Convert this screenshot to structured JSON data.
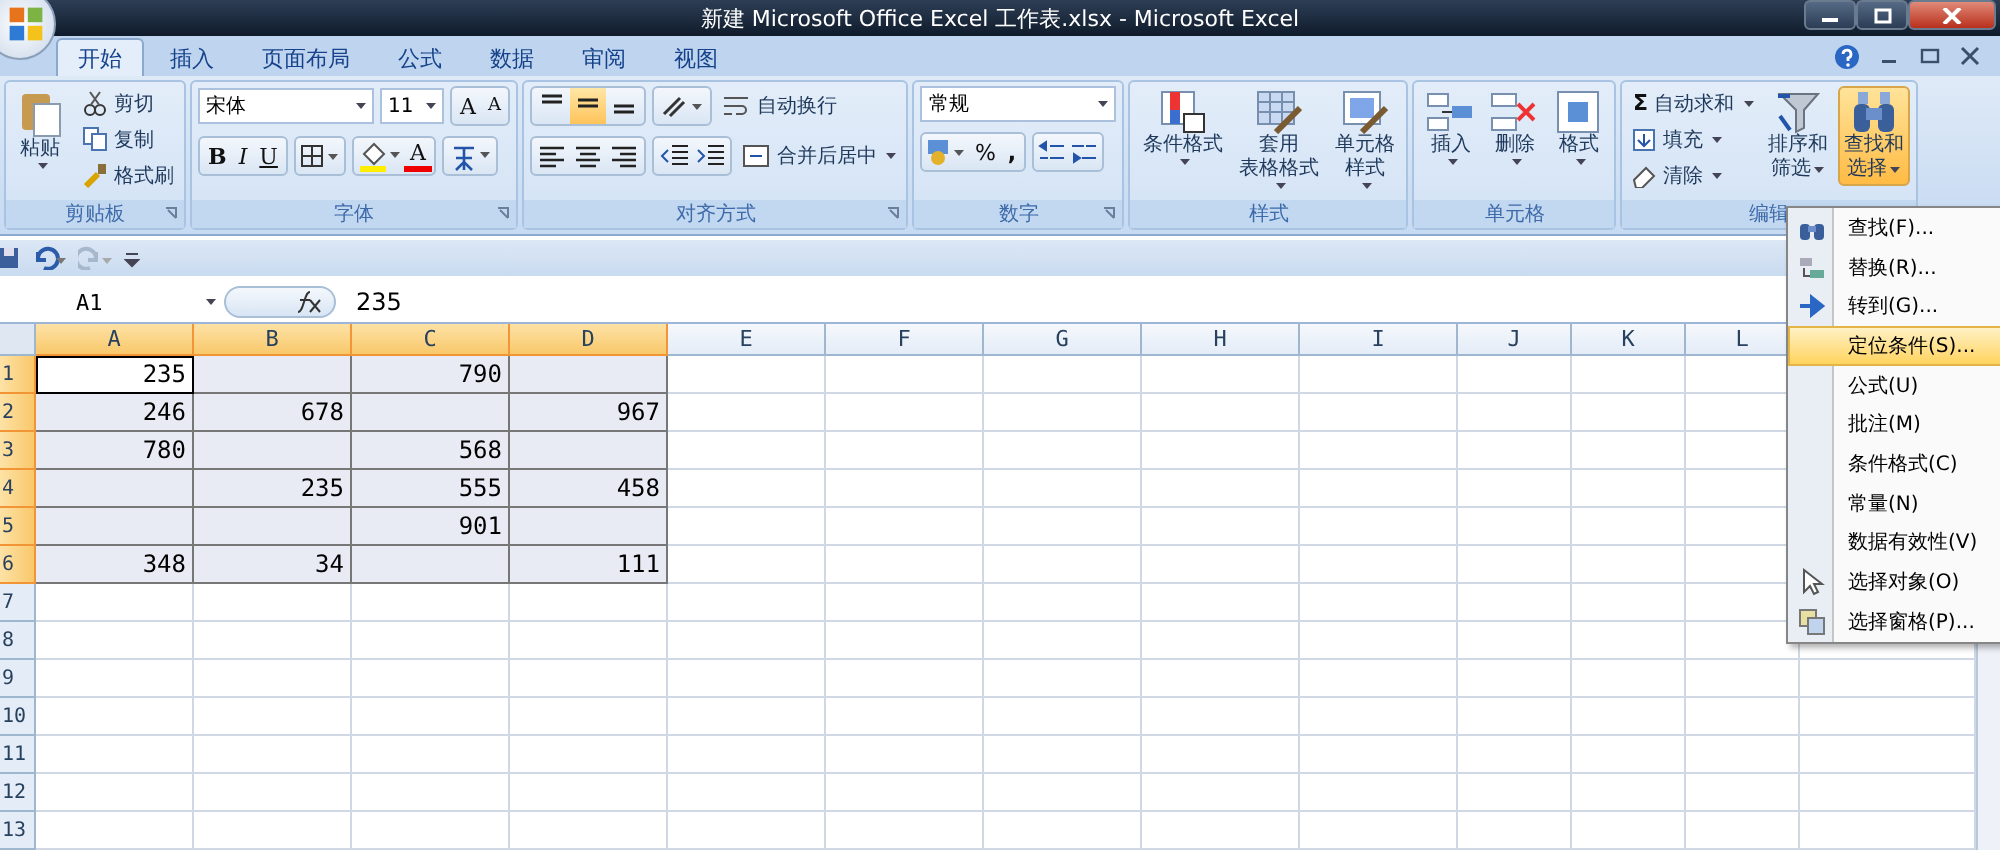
{
  "window": {
    "title": "新建 Microsoft Office Excel 工作表.xlsx - Microsoft Excel"
  },
  "tabs": [
    {
      "label": "开始",
      "selected": true
    },
    {
      "label": "插入",
      "selected": false
    },
    {
      "label": "页面布局",
      "selected": false
    },
    {
      "label": "公式",
      "selected": false
    },
    {
      "label": "数据",
      "selected": false
    },
    {
      "label": "审阅",
      "selected": false
    },
    {
      "label": "视图",
      "selected": false
    }
  ],
  "clipboard": {
    "label": "剪贴板",
    "paste": "粘贴",
    "items": [
      {
        "kind": "cut",
        "label": "剪切"
      },
      {
        "kind": "copy",
        "label": "复制"
      },
      {
        "kind": "brush",
        "label": "格式刷"
      }
    ]
  },
  "font": {
    "label": "字体",
    "name": "宋体",
    "size": "11",
    "grow": "A",
    "shrink": "A",
    "bold": "B",
    "italic": "I",
    "underline": "U",
    "color_letter": "A"
  },
  "alignment": {
    "label": "对齐方式",
    "vertical": [
      {
        "selected": false
      },
      {
        "selected": true
      },
      {
        "selected": false
      }
    ],
    "wrap": "自动换行",
    "merge": "合并后居中"
  },
  "number": {
    "label": "数字",
    "format": "常规",
    "percent": "%",
    "comma": ","
  },
  "styles": {
    "label": "样式",
    "buttons": [
      {
        "kind": "conditional",
        "lines": [
          "条件格式"
        ]
      },
      {
        "kind": "table",
        "lines": [
          "套用",
          "表格格式"
        ]
      },
      {
        "kind": "cellstyle",
        "lines": [
          "单元格",
          "样式"
        ]
      }
    ]
  },
  "cells": {
    "label": "单元格",
    "buttons": [
      {
        "kind": "insert",
        "label": "插入"
      },
      {
        "kind": "delete",
        "label": "删除"
      },
      {
        "kind": "format",
        "label": "格式"
      }
    ]
  },
  "editing": {
    "label": "编辑",
    "sigma": "Σ",
    "items": [
      {
        "kind": "sum",
        "label": "自动求和"
      },
      {
        "kind": "fill",
        "label": "填充"
      },
      {
        "kind": "clear",
        "label": "清除"
      }
    ],
    "sort": [
      "排序和",
      "筛选"
    ],
    "find": {
      "lines": [
        "查找和",
        "选择"
      ],
      "active": true
    }
  },
  "formula_bar": {
    "name_box": "A1",
    "value": "235"
  },
  "sheet": {
    "columns": [
      {
        "label": "A",
        "selected": true
      },
      {
        "label": "B",
        "selected": true
      },
      {
        "label": "C",
        "selected": true
      },
      {
        "label": "D",
        "selected": true
      },
      {
        "label": "E",
        "selected": false
      },
      {
        "label": "F",
        "selected": false
      },
      {
        "label": "G",
        "selected": false
      },
      {
        "label": "H",
        "selected": false
      },
      {
        "label": "I",
        "selected": false
      },
      {
        "label": "J",
        "selected": false
      },
      {
        "label": "K",
        "selected": false
      },
      {
        "label": "L",
        "selected": false
      }
    ],
    "rows": [
      {
        "label": "1",
        "selected": true,
        "cells": [
          "235",
          "",
          "790",
          ""
        ]
      },
      {
        "label": "2",
        "selected": true,
        "cells": [
          "246",
          "678",
          "",
          "967"
        ]
      },
      {
        "label": "3",
        "selected": true,
        "cells": [
          "780",
          "",
          "568",
          ""
        ]
      },
      {
        "label": "4",
        "selected": true,
        "cells": [
          "",
          "235",
          "555",
          "458"
        ]
      },
      {
        "label": "5",
        "selected": true,
        "cells": [
          "",
          "",
          "901",
          ""
        ]
      },
      {
        "label": "6",
        "selected": true,
        "cells": [
          "348",
          "34",
          "",
          "111"
        ]
      },
      {
        "label": "7",
        "selected": false,
        "cells": []
      },
      {
        "label": "8",
        "selected": false,
        "cells": []
      },
      {
        "label": "9",
        "selected": false,
        "cells": []
      },
      {
        "label": "10",
        "selected": false,
        "cells": []
      },
      {
        "label": "11",
        "selected": false,
        "cells": []
      },
      {
        "label": "12",
        "selected": false,
        "cells": []
      },
      {
        "label": "13",
        "selected": false,
        "cells": []
      }
    ]
  },
  "menu": {
    "items": [
      {
        "kind": "binoculars",
        "label": "查找(F)...",
        "selected": false
      },
      {
        "kind": "replace",
        "label": "替换(R)...",
        "selected": false
      },
      {
        "kind": "arrow",
        "label": "转到(G)...",
        "selected": false
      },
      {
        "kind": "none",
        "label": "定位条件(S)...",
        "selected": true
      },
      {
        "kind": "none",
        "label": "公式(U)",
        "selected": false
      },
      {
        "kind": "none",
        "label": "批注(M)",
        "selected": false
      },
      {
        "kind": "none",
        "label": "条件格式(C)",
        "selected": false
      },
      {
        "kind": "none",
        "label": "常量(N)",
        "selected": false
      },
      {
        "kind": "none",
        "label": "数据有效性(V)",
        "selected": false
      },
      {
        "kind": "pointer",
        "label": "选择对象(O)",
        "selected": false
      },
      {
        "kind": "panes",
        "label": "选择窗格(P)...",
        "selected": false
      }
    ]
  }
}
